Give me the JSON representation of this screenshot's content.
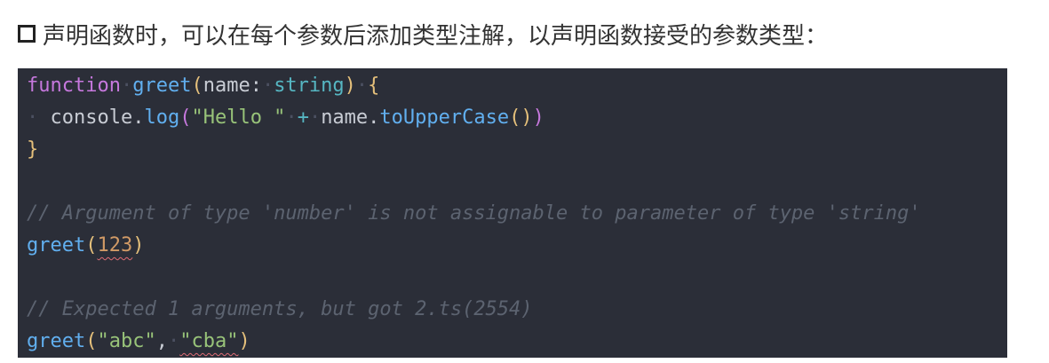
{
  "heading": {
    "icon": "square-bullet-icon",
    "text": "声明函数时，可以在每个参数后添加类型注解，以声明函数接受的参数类型："
  },
  "code": {
    "line1": {
      "kw": "function",
      "name": "greet",
      "open": "(",
      "param": "name",
      "colon": ":",
      "type": "string",
      "close": ")",
      "brace": "{"
    },
    "line2": {
      "obj": "console.",
      "method": "log",
      "open": "(",
      "str": "\"Hello \"",
      "op": "+",
      "ident": "name.",
      "call": "toUpperCase",
      "parens": "()",
      "close": ")"
    },
    "line3": {
      "brace": "}"
    },
    "comment1": "// Argument of type 'number' is not assignable to parameter of type 'string'",
    "call1": {
      "name": "greet",
      "open": "(",
      "arg": "123",
      "close": ")"
    },
    "comment2": "// Expected 1 arguments, but got 2.ts(2554)",
    "call2": {
      "name": "greet",
      "open": "(",
      "arg1": "\"abc\"",
      "comma": ",",
      "arg2": "\"cba\"",
      "close": ")"
    }
  },
  "colors": {
    "background": "#2b2e38",
    "keyword": "#c678dd",
    "function": "#61afef",
    "string": "#98c379",
    "number": "#d19a66",
    "comment": "#5c6370",
    "error_underline": "#e06c75"
  }
}
